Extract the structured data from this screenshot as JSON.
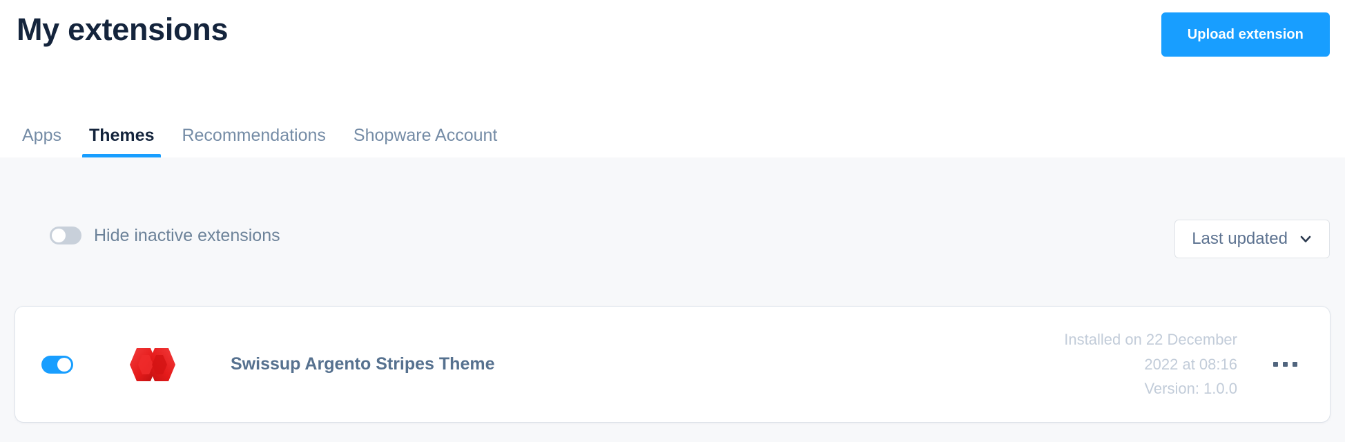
{
  "header": {
    "title": "My extensions",
    "upload_button": "Upload extension"
  },
  "tabs": [
    {
      "label": "Apps",
      "active": false
    },
    {
      "label": "Themes",
      "active": true
    },
    {
      "label": "Recommendations",
      "active": false
    },
    {
      "label": "Shopware Account",
      "active": false
    }
  ],
  "filter_bar": {
    "hide_inactive_label": "Hide inactive extensions",
    "hide_inactive_value": "off",
    "sort_selected": "Last updated"
  },
  "extensions": [
    {
      "name": "Swissup Argento Stripes Theme",
      "active": "on",
      "installed_line1": "Installed on 22 December",
      "installed_line2": "2022 at 08:16",
      "version_line": "Version: 1.0.0"
    }
  ],
  "colors": {
    "accent": "#189eff",
    "title": "#14243c",
    "muted": "#758ca6",
    "meta": "#c2ccd9",
    "logo_red": "#e51b1b",
    "page_bg": "#f7f8fa"
  }
}
